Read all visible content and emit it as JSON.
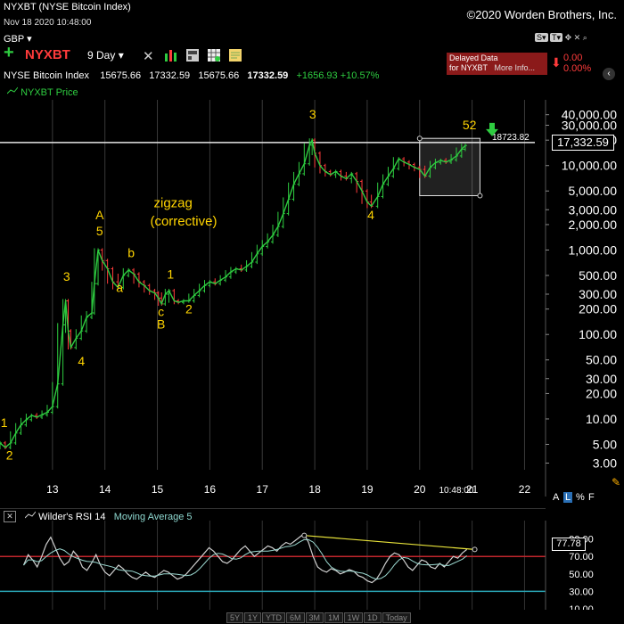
{
  "window": {
    "title": "NYXBT (NYSE Bitcoin Index)",
    "datetime": "Nov 18 2020 10:48:00",
    "copyright": "©2020 Worden Brothers, Inc."
  },
  "toolbar": {
    "currency": "GBP",
    "symbol": "NYXBT",
    "period": "9 Day",
    "delayed_line1": "Delayed Data",
    "delayed_line2_a": "for NYXBT",
    "delayed_line2_b": "More Info...",
    "change_a": "0.00",
    "change_b": "0.00%",
    "icons": [
      "plus-icon",
      "tools-icon",
      "bar-chart-icon",
      "grid-icon",
      "note-icon",
      "scale-s-icon",
      "scale-t-icon",
      "move-icon",
      "close-icon",
      "zoom-icon"
    ]
  },
  "quote": {
    "name": "NYSE Bitcoin Index",
    "open": "15675.66",
    "high": "17332.59",
    "low": "15675.66",
    "close": "17332.59",
    "change": "+1656.93",
    "change_pct": "+10.57%"
  },
  "legend": {
    "price_label": "NYXBT Price"
  },
  "price_tag": "17,332.59",
  "hline_label": "18723.82",
  "scale_buttons": {
    "a": "A",
    "l": "L",
    "pct": "%",
    "f": "F"
  },
  "rsi": {
    "title": "Wilder's RSI 14",
    "ma": "Moving Average 5",
    "value_tag": "77.78"
  },
  "bottom_buttons": [
    "5Y",
    "1Y",
    "YTD",
    "6M",
    "3M",
    "1M",
    "1W",
    "1D",
    "Today"
  ],
  "colors": {
    "up": "#2ecc40",
    "down": "#ff3b3b",
    "wave": "#ffd400",
    "rsi_upper": "#c0262d",
    "rsi_lower": "#2aa5b5",
    "rsi_line": "#cfcfcf",
    "ma_line": "#9bd8d0"
  },
  "chart_data": {
    "type": "line",
    "title": "NYXBT Price",
    "y_scale": "log",
    "ylim": [
      2.5,
      60000
    ],
    "xlim": [
      12.0,
      22.4
    ],
    "x_ticks": [
      "13",
      "14",
      "15",
      "16",
      "17",
      "18",
      "19",
      "20",
      "21",
      "22"
    ],
    "x_time_label": "10:48:00",
    "y_ticks": [
      {
        "v": 40000,
        "label": "40,000.00"
      },
      {
        "v": 30000,
        "label": "30,000.00"
      },
      {
        "v": 20000,
        "label": "20,000.00"
      },
      {
        "v": 10000,
        "label": "10,000.00"
      },
      {
        "v": 5000,
        "label": "5,000.00"
      },
      {
        "v": 3000,
        "label": "3,000.00"
      },
      {
        "v": 2000,
        "label": "2,000.00"
      },
      {
        "v": 1000,
        "label": "1,000.00"
      },
      {
        "v": 500,
        "label": "500.00"
      },
      {
        "v": 300,
        "label": "300.00"
      },
      {
        "v": 200,
        "label": "200.00"
      },
      {
        "v": 100,
        "label": "100.00"
      },
      {
        "v": 50,
        "label": "50.00"
      },
      {
        "v": 30,
        "label": "30.00"
      },
      {
        "v": 20,
        "label": "20.00"
      },
      {
        "v": 10,
        "label": "10.00"
      },
      {
        "v": 5,
        "label": "5.00"
      },
      {
        "v": 3,
        "label": "3.00"
      }
    ],
    "series": [
      {
        "name": "NYXBT Price",
        "points": [
          [
            12.0,
            5.2
          ],
          [
            12.1,
            4.6
          ],
          [
            12.2,
            5.2
          ],
          [
            12.3,
            6.8
          ],
          [
            12.4,
            8.5
          ],
          [
            12.5,
            9.8
          ],
          [
            12.6,
            11
          ],
          [
            12.7,
            10.5
          ],
          [
            12.8,
            11.2
          ],
          [
            12.9,
            12
          ],
          [
            13.0,
            14
          ],
          [
            13.1,
            26
          ],
          [
            13.2,
            130
          ],
          [
            13.25,
            250
          ],
          [
            13.3,
            110
          ],
          [
            13.35,
            70
          ],
          [
            13.45,
            90
          ],
          [
            13.55,
            110
          ],
          [
            13.65,
            160
          ],
          [
            13.75,
            180
          ],
          [
            13.8,
            400
          ],
          [
            13.87,
            1000
          ],
          [
            13.95,
            750
          ],
          [
            14.05,
            600
          ],
          [
            14.15,
            420
          ],
          [
            14.25,
            360
          ],
          [
            14.35,
            500
          ],
          [
            14.45,
            580
          ],
          [
            14.55,
            520
          ],
          [
            14.65,
            420
          ],
          [
            14.75,
            380
          ],
          [
            14.85,
            330
          ],
          [
            14.95,
            310
          ],
          [
            15.02,
            270
          ],
          [
            15.08,
            230
          ],
          [
            15.15,
            300
          ],
          [
            15.22,
            330
          ],
          [
            15.32,
            250
          ],
          [
            15.4,
            240
          ],
          [
            15.5,
            250
          ],
          [
            15.6,
            250
          ],
          [
            15.7,
            290
          ],
          [
            15.8,
            330
          ],
          [
            15.9,
            380
          ],
          [
            16.0,
            420
          ],
          [
            16.1,
            400
          ],
          [
            16.2,
            440
          ],
          [
            16.3,
            480
          ],
          [
            16.4,
            550
          ],
          [
            16.5,
            600
          ],
          [
            16.6,
            580
          ],
          [
            16.7,
            640
          ],
          [
            16.8,
            720
          ],
          [
            16.9,
            900
          ],
          [
            17.0,
            1100
          ],
          [
            17.1,
            1250
          ],
          [
            17.2,
            1500
          ],
          [
            17.3,
            1900
          ],
          [
            17.4,
            2700
          ],
          [
            17.5,
            4000
          ],
          [
            17.6,
            6000
          ],
          [
            17.7,
            8000
          ],
          [
            17.8,
            10500
          ],
          [
            17.9,
            17500
          ],
          [
            17.95,
            20000
          ],
          [
            18.0,
            14000
          ],
          [
            18.1,
            10000
          ],
          [
            18.2,
            8500
          ],
          [
            18.3,
            7800
          ],
          [
            18.4,
            8500
          ],
          [
            18.5,
            7500
          ],
          [
            18.6,
            7000
          ],
          [
            18.7,
            8000
          ],
          [
            18.8,
            6500
          ],
          [
            18.9,
            5000
          ],
          [
            19.0,
            3700
          ],
          [
            19.08,
            3300
          ],
          [
            19.2,
            4300
          ],
          [
            19.3,
            6000
          ],
          [
            19.4,
            7500
          ],
          [
            19.5,
            9200
          ],
          [
            19.6,
            12000
          ],
          [
            19.7,
            11000
          ],
          [
            19.8,
            10300
          ],
          [
            19.9,
            9500
          ],
          [
            20.0,
            9000
          ],
          [
            20.1,
            7500
          ],
          [
            20.2,
            9500
          ],
          [
            20.3,
            10800
          ],
          [
            20.4,
            11500
          ],
          [
            20.5,
            11000
          ],
          [
            20.6,
            11700
          ],
          [
            20.7,
            13000
          ],
          [
            20.8,
            15600
          ],
          [
            20.87,
            17300
          ]
        ]
      }
    ],
    "hline": 18723.82,
    "box": {
      "x0": 20.0,
      "x1": 21.15,
      "y0": 4400,
      "y1": 21000
    },
    "wave_labels": [
      {
        "x": 12.08,
        "y": 8.0,
        "text": "1"
      },
      {
        "x": 12.18,
        "y": 3.3,
        "text": "2"
      },
      {
        "x": 13.27,
        "y": 430,
        "text": "3"
      },
      {
        "x": 13.55,
        "y": 43,
        "text": "4"
      },
      {
        "x": 13.9,
        "y": 2300,
        "text": "A"
      },
      {
        "x": 13.9,
        "y": 1500,
        "text": "5"
      },
      {
        "x": 14.5,
        "y": 820,
        "text": "b"
      },
      {
        "x": 14.28,
        "y": 320,
        "text": "a"
      },
      {
        "x": 15.25,
        "y": 460,
        "text": "1"
      },
      {
        "x": 15.07,
        "y": 165,
        "text": "c"
      },
      {
        "x": 15.07,
        "y": 118,
        "text": "B"
      },
      {
        "x": 15.6,
        "y": 178,
        "text": "2"
      },
      {
        "x": 17.96,
        "y": 36000,
        "text": "3"
      },
      {
        "x": 19.07,
        "y": 2300,
        "text": "4"
      },
      {
        "x": 20.95,
        "y": 27000,
        "text": "52"
      }
    ],
    "annotations": [
      {
        "x": 15.3,
        "y": 3200,
        "text": "zigzag"
      },
      {
        "x": 15.5,
        "y": 1950,
        "text": "(corrective)"
      }
    ]
  },
  "rsi_data": {
    "ylim": [
      10,
      110
    ],
    "upper": 70,
    "lower": 30,
    "y_ticks": [
      "90.00",
      "70.00",
      "50.00",
      "30.00",
      "10.00"
    ],
    "trendline": [
      [
        17.8,
        94
      ],
      [
        21.05,
        78
      ]
    ],
    "values": [
      60,
      72,
      66,
      58,
      70,
      84,
      92,
      80,
      68,
      60,
      64,
      76,
      70,
      58,
      54,
      62,
      72,
      60,
      52,
      48,
      54,
      60,
      56,
      50,
      46,
      44,
      48,
      52,
      48,
      46,
      50,
      54,
      52,
      48,
      44,
      46,
      50,
      56,
      62,
      68,
      74,
      80,
      76,
      70,
      64,
      62,
      66,
      72,
      78,
      82,
      76,
      70,
      74,
      78,
      82,
      80,
      76,
      82,
      86,
      84,
      88,
      92,
      96,
      86,
      70,
      58,
      54,
      52,
      56,
      54,
      50,
      52,
      55,
      53,
      48,
      46,
      42,
      40,
      44,
      52,
      62,
      70,
      74,
      72,
      66,
      58,
      54,
      60,
      66,
      64,
      58,
      56,
      62,
      58,
      64,
      70,
      68,
      74,
      78
    ]
  }
}
